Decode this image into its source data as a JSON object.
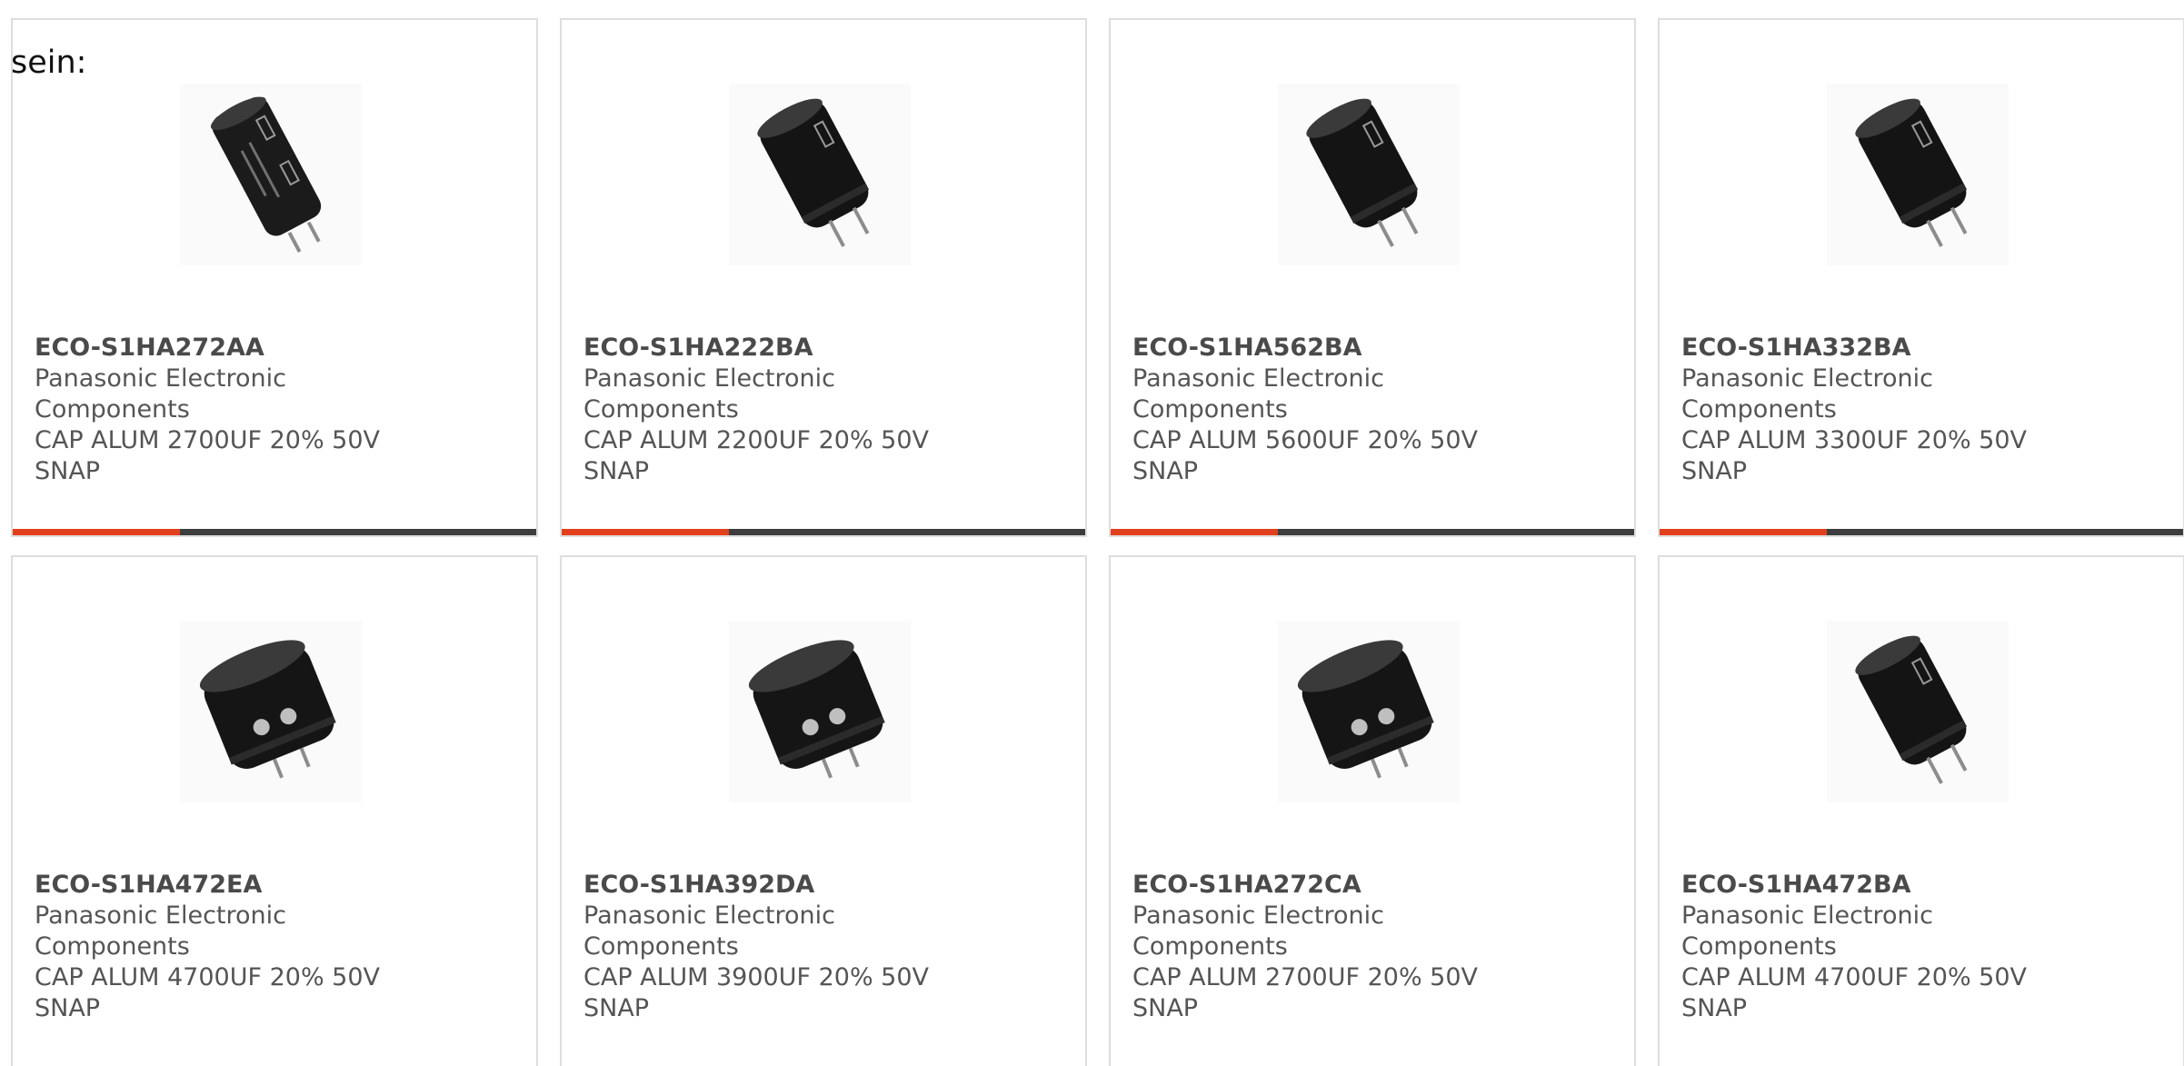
{
  "heading_fragment": "sein:",
  "accent_color": "#e2401c",
  "bar_color": "#3d3d3d",
  "products": [
    {
      "part": "ECO-S1HA272AA",
      "manufacturer": "Panasonic Electronic Components",
      "desc_line1": "CAP ALUM 2700UF 20% 50V",
      "desc_line2": "SNAP",
      "image_icon": "capacitor-tilted-icon",
      "accent_progress": 0.32
    },
    {
      "part": "ECO-S1HA222BA",
      "manufacturer": "Panasonic Electronic Components",
      "desc_line1": "CAP ALUM 2200UF 20% 50V",
      "desc_line2": "SNAP",
      "image_icon": "capacitor-upright-icon",
      "accent_progress": 0.32
    },
    {
      "part": "ECO-S1HA562BA",
      "manufacturer": "Panasonic Electronic Components",
      "desc_line1": "CAP ALUM 5600UF 20% 50V",
      "desc_line2": "SNAP",
      "image_icon": "capacitor-upright-icon",
      "accent_progress": 0.32
    },
    {
      "part": "ECO-S1HA332BA",
      "manufacturer": "Panasonic Electronic Components",
      "desc_line1": "CAP ALUM 3300UF 20% 50V",
      "desc_line2": "SNAP",
      "image_icon": "capacitor-upright-icon",
      "accent_progress": 0.32
    },
    {
      "part": "ECO-S1HA472EA",
      "manufacturer": "Panasonic Electronic Components",
      "desc_line1": "CAP ALUM 4700UF 20% 50V",
      "desc_line2": "SNAP",
      "image_icon": "capacitor-squat-icon",
      "accent_progress": 0
    },
    {
      "part": "ECO-S1HA392DA",
      "manufacturer": "Panasonic Electronic Components",
      "desc_line1": "CAP ALUM 3900UF 20% 50V",
      "desc_line2": "SNAP",
      "image_icon": "capacitor-squat-icon",
      "accent_progress": 0
    },
    {
      "part": "ECO-S1HA272CA",
      "manufacturer": "Panasonic Electronic Components",
      "desc_line1": "CAP ALUM 2700UF 20% 50V",
      "desc_line2": "SNAP",
      "image_icon": "capacitor-squat-icon",
      "accent_progress": 0
    },
    {
      "part": "ECO-S1HA472BA",
      "manufacturer": "Panasonic Electronic Components",
      "desc_line1": "CAP ALUM 4700UF 20% 50V",
      "desc_line2": "SNAP",
      "image_icon": "capacitor-upright-icon",
      "accent_progress": 0
    }
  ]
}
